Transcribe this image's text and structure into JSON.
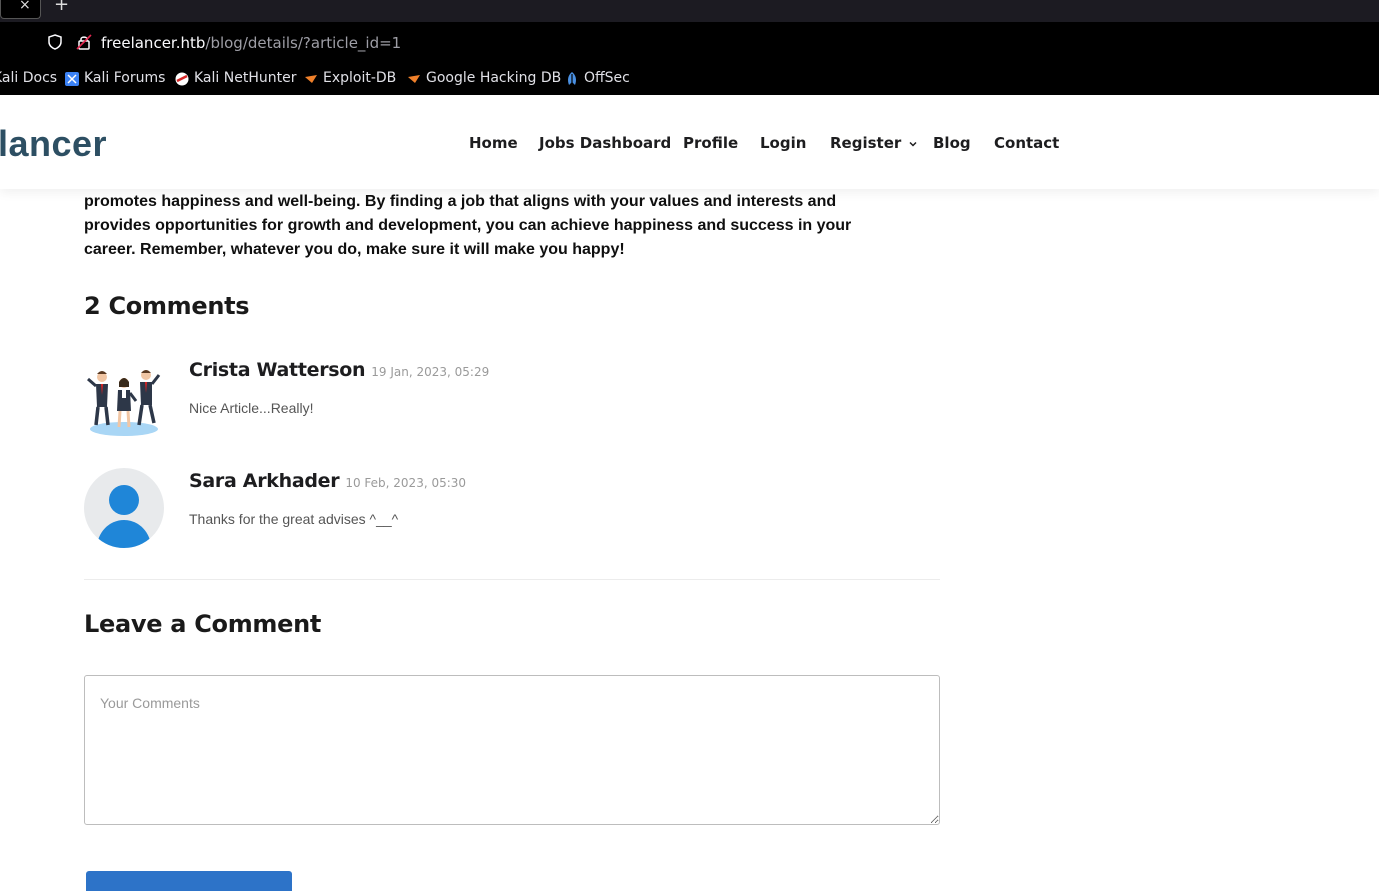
{
  "browser": {
    "url_host": "freelancer.htb",
    "url_path": "/blog/details/?article_id=1",
    "bookmarks": [
      "Kali Docs",
      "Kali Forums",
      "Kali NetHunter",
      "Exploit-DB",
      "Google Hacking DB",
      "OffSec"
    ]
  },
  "site": {
    "logo": "lancer",
    "nav": [
      "Home",
      "Jobs Dashboard",
      "Profile",
      "Login",
      "Register",
      "Blog",
      "Contact"
    ]
  },
  "article": {
    "tail": "promotes happiness and well-being. By finding a job that aligns with your values and interests and provides opportunities for growth and development, you can achieve happiness and success in your career. Remember, whatever you do, make sure it will make you happy!"
  },
  "comments": {
    "title": "2 Comments",
    "items": [
      {
        "name": "Crista Watterson",
        "date": "19 Jan, 2023, 05:29",
        "text": "Nice Article...Really!",
        "avatar": "team-celebration-illustration"
      },
      {
        "name": "Sara Arkhader",
        "date": "10 Feb, 2023, 05:30",
        "text": "Thanks for the great advises ^__^",
        "avatar": "default-user-icon"
      }
    ]
  },
  "form": {
    "title": "Leave a Comment",
    "placeholder": "Your Comments"
  },
  "colors": {
    "logo": "#2d4f63",
    "avatar_blue": "#1f86d8",
    "button": "#2d73c8"
  }
}
